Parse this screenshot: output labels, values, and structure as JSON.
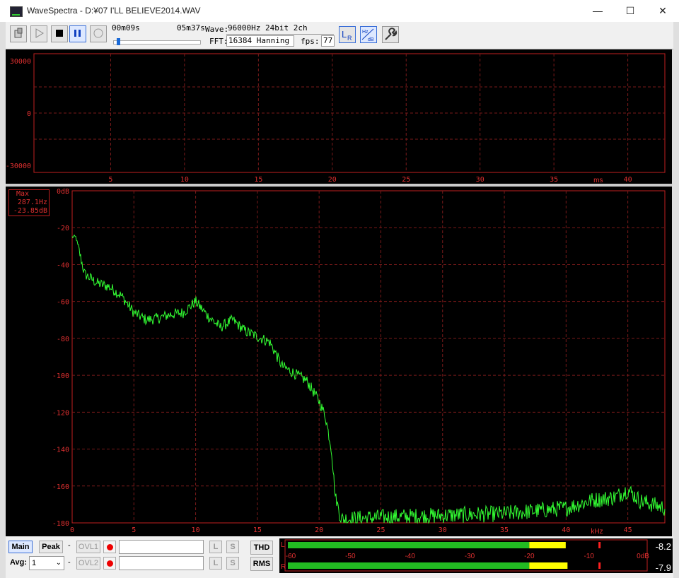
{
  "window": {
    "title": "WaveSpectra - D:¥07 I'LL BELIEVE2014.WAV",
    "min": "—",
    "max": "☐",
    "close": "✕"
  },
  "toolbar": {
    "time_current": "00m09s",
    "time_total": "05m37s",
    "seek_progress": 0.03,
    "wave_label": "Wave:",
    "wave_value": "96000Hz 24bit 2ch",
    "fft_label": "FFT:",
    "fft_value": "16384 Hanning",
    "fps_label": "fps:",
    "fps_value": "77"
  },
  "wave_chart": {
    "y_ticks": [
      "30000",
      "0",
      "-30000"
    ],
    "x_ticks": [
      "5",
      "10",
      "15",
      "20",
      "25",
      "30",
      "35",
      "40"
    ],
    "x_unit": "ms"
  },
  "spectrum_chart": {
    "marker_title": "Max",
    "marker_freq": "287.1Hz",
    "marker_level": "-23.85dB",
    "y_ticks": [
      "0dB",
      "-20",
      "-40",
      "-60",
      "-80",
      "-100",
      "-120",
      "-140",
      "-160",
      "-180"
    ],
    "x_ticks": [
      "0",
      "5",
      "10",
      "15",
      "20",
      "25",
      "30",
      "35",
      "40",
      "45"
    ],
    "x_unit": "kHz"
  },
  "chart_data": {
    "type": "line",
    "xlim": [
      0,
      48
    ],
    "ylim": [
      -180,
      0
    ],
    "series": [
      {
        "name": "",
        "x": [
          0.3,
          1,
          2,
          3,
          4,
          5,
          6,
          7,
          8,
          9,
          10,
          11,
          12,
          13,
          14,
          15,
          16,
          17,
          18,
          19,
          20,
          20.5,
          21,
          21.3,
          21.8,
          22,
          25,
          30,
          35,
          40,
          42,
          44,
          45,
          46,
          48
        ],
        "values": [
          -25,
          -45,
          -50,
          -52,
          -57,
          -66,
          -70,
          -69,
          -67,
          -66,
          -60,
          -68,
          -74,
          -70,
          -76,
          -79,
          -82,
          -95,
          -99,
          -103,
          -114,
          -122,
          -140,
          -165,
          -178,
          -178,
          -177,
          -176,
          -175,
          -172,
          -168,
          -166,
          -162,
          -168,
          -172
        ]
      }
    ]
  },
  "bottom": {
    "main": "Main",
    "peak": "Peak",
    "dash": "-",
    "ovl1": "OVL1",
    "ovl2": "OVL2",
    "avg_label": "Avg:",
    "avg_value": "1",
    "l": "L",
    "s": "S",
    "thd": "THD",
    "rms": "RMS"
  },
  "meter": {
    "ch_l": "L",
    "ch_r": "R",
    "scale": [
      "-60",
      "-50",
      "-40",
      "-30",
      "-20",
      "-10",
      "0dB"
    ],
    "l_value": "-8.2",
    "r_value": "-7.9"
  },
  "colors": {
    "trace": "#33ff33",
    "grid": "#7a1a1a",
    "frame": "#c02020",
    "label": "#e03030",
    "meter_green": "#22bb22",
    "meter_yellow": "#ffff00"
  }
}
